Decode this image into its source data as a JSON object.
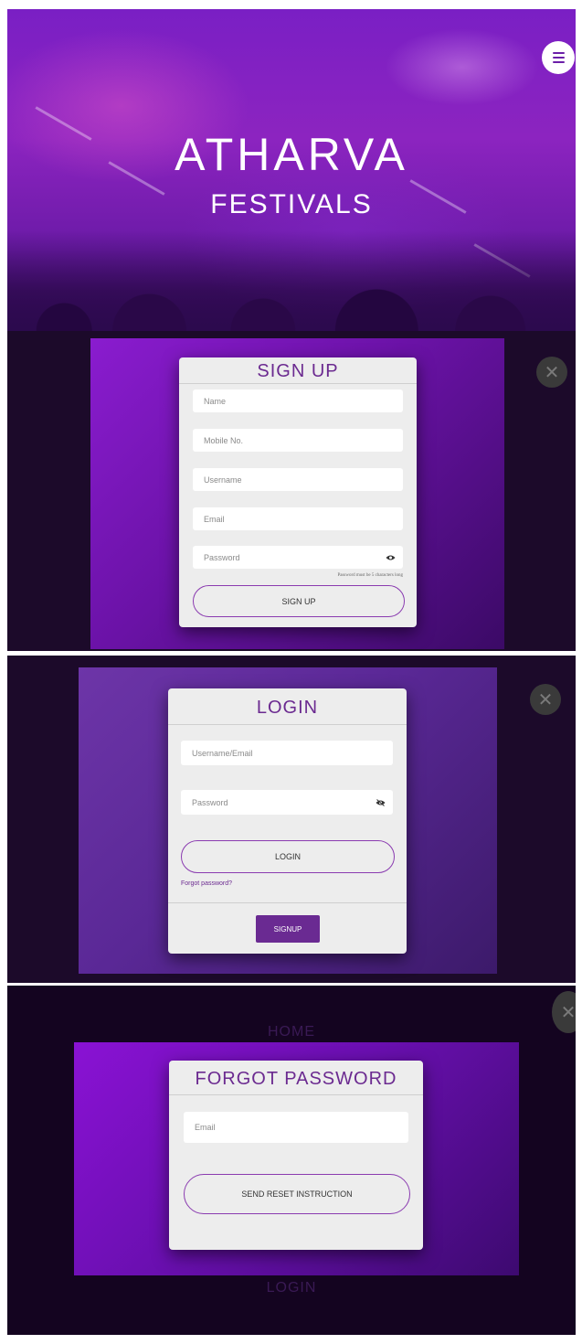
{
  "hero": {
    "title": "ATHARVA",
    "subtitle": "FESTIVALS"
  },
  "signup": {
    "title": "SIGN UP",
    "fields": [
      {
        "placeholder": "Name"
      },
      {
        "placeholder": "Mobile No."
      },
      {
        "placeholder": "Username"
      },
      {
        "placeholder": "Email"
      },
      {
        "placeholder": "Password"
      }
    ],
    "password_hint": "Password must be 5 characters long",
    "submit_label": "SIGN UP",
    "close_glyph": "✕"
  },
  "login": {
    "title": "LOGIN",
    "fields": [
      {
        "placeholder": "Username/Email"
      },
      {
        "placeholder": "Password"
      }
    ],
    "submit_label": "LOGIN",
    "forgot_link": "Forgot password?",
    "signup_label": "SIGNUP",
    "close_glyph": "✕"
  },
  "forgot": {
    "background_top_label": "HOME",
    "background_bottom_label": "LOGIN",
    "title": "FORGOT PASSWORD",
    "fields": [
      {
        "placeholder": "Email"
      }
    ],
    "submit_label": "SEND RESET INSTRUCTION",
    "close_glyph": "✕"
  },
  "colors": {
    "accent": "#6b2a90",
    "button_border": "#8a3bb0",
    "signup_button": "#6a2a92"
  },
  "icons": [
    "menu-icon",
    "close-icon",
    "eye-icon",
    "eye-slash-icon"
  ]
}
